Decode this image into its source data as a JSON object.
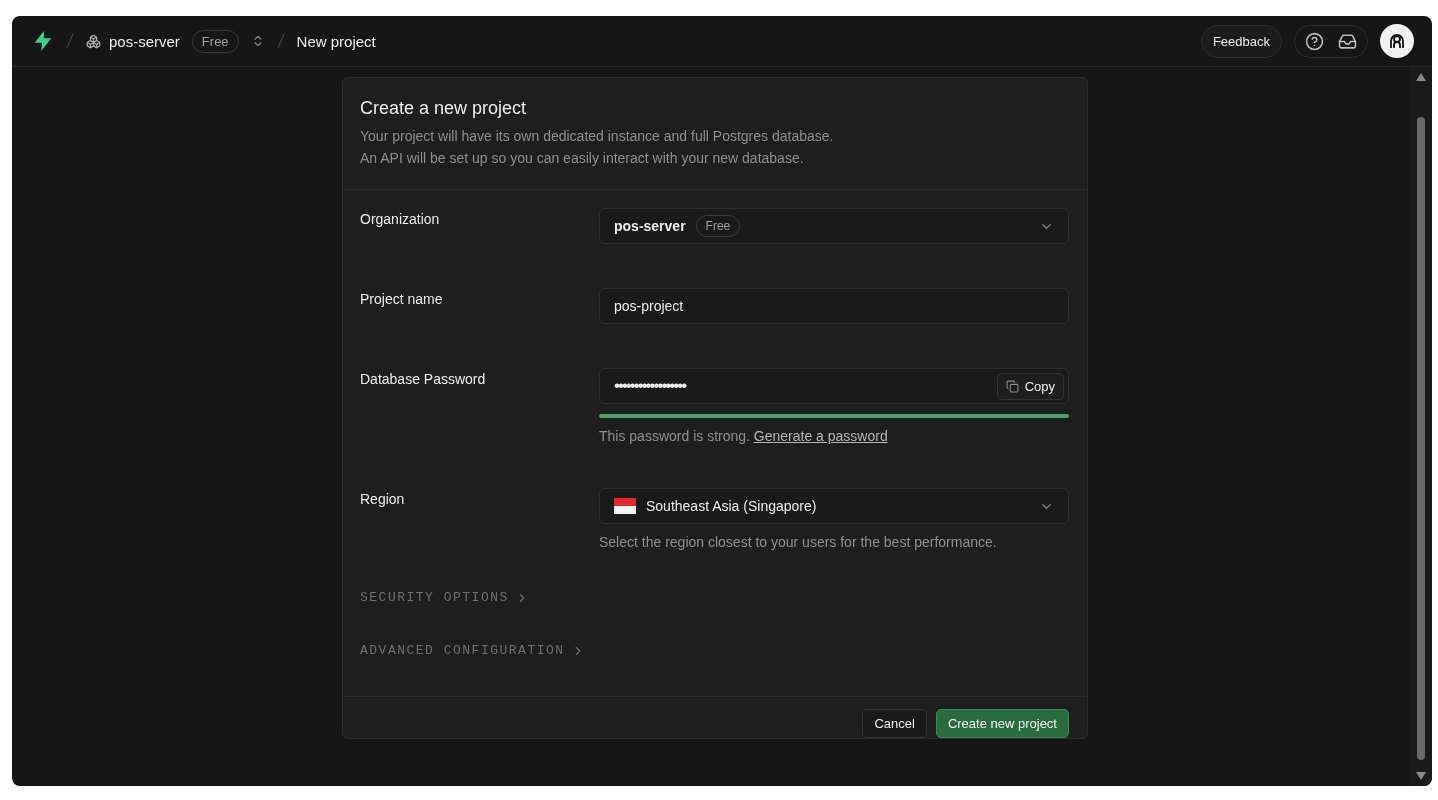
{
  "breadcrumb": {
    "org": "pos-server",
    "plan": "Free",
    "page": "New project"
  },
  "topbar": {
    "feedback": "Feedback"
  },
  "card": {
    "title": "Create a new project",
    "description": [
      "Your project will have its own dedicated instance and full Postgres database.",
      "An API will be set up so you can easily interact with your new database."
    ]
  },
  "fields": [
    {
      "kind": "org-select",
      "label": "Organization",
      "value": "pos-server",
      "badge": "Free"
    },
    {
      "kind": "text",
      "label": "Project name",
      "value": "pos-project"
    },
    {
      "kind": "password",
      "label": "Database Password",
      "value": "••••••••••••••••••",
      "copy": "Copy",
      "level": 1,
      "hint": "This password is strong.",
      "link": "Generate a password"
    },
    {
      "kind": "region-select",
      "label": "Region",
      "value": "Southeast Asia (Singapore)",
      "hint": "Select the region closest to your users for the best performance."
    }
  ],
  "sections": [
    {
      "label": "SECURITY OPTIONS",
      "expanded": false
    },
    {
      "label": "ADVANCED CONFIGURATION",
      "expanded": false
    }
  ],
  "buttons": {
    "cancel": "Cancel",
    "create": "Create new project"
  }
}
